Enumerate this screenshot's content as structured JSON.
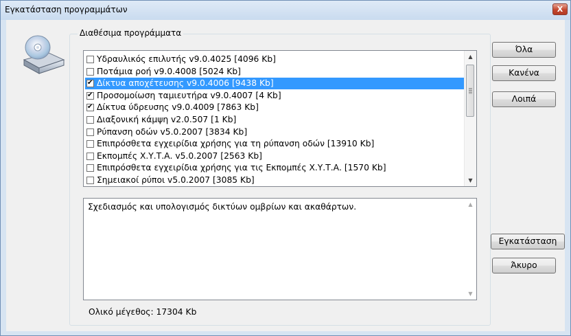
{
  "window": {
    "title": "Εγκατάσταση προγραμμάτων",
    "close_label": "X"
  },
  "group": {
    "label": "Διαθέσιμα προγράμματα"
  },
  "programs": [
    {
      "label": "Υδραυλικός επιλυτής v9.0.4025 [4096 Kb]",
      "checked": false,
      "selected": false
    },
    {
      "label": "Ποτάμια ροή v9.0.4008 [5024 Kb]",
      "checked": false,
      "selected": false
    },
    {
      "label": "Δίκτυα αποχέτευσης v9.0.4006 [9438 Kb]",
      "checked": true,
      "selected": true
    },
    {
      "label": "Προσομοίωση ταμιευτήρα v9.0.4007 [4 Kb]",
      "checked": true,
      "selected": false
    },
    {
      "label": "Δίκτυα ύδρευσης v9.0.4009 [7863 Kb]",
      "checked": true,
      "selected": false
    },
    {
      "label": "Διαξονική κάμψη v2.0.507 [1 Kb]",
      "checked": false,
      "selected": false
    },
    {
      "label": "Ρύπανση οδών v5.0.2007 [3834 Kb]",
      "checked": false,
      "selected": false
    },
    {
      "label": "Επιπρόσθετα εγχειρίδια χρήσης για τη ρύπανση οδών [13910 Kb]",
      "checked": false,
      "selected": false
    },
    {
      "label": "Εκπομπές Χ.Υ.Τ.Α. v5.0.2007 [2563 Kb]",
      "checked": false,
      "selected": false
    },
    {
      "label": "Επιπρόσθετα εγχειρίδια χρήσης για τις Εκπομπές Χ.Υ.Τ.Α. [1570 Kb]",
      "checked": false,
      "selected": false
    },
    {
      "label": "Σημειακοί ρύποι v5.0.2007 [3085 Kb]",
      "checked": false,
      "selected": false
    }
  ],
  "description": "Σχεδιασμός και υπολογισμός δικτύων ομβρίων και ακαθάρτων.",
  "total": "Ολικό μέγεθος: 17304 Kb",
  "buttons": {
    "all": "Όλα",
    "none": "Κανένα",
    "rest": "Λοιπά",
    "install": "Εγκατάσταση",
    "cancel": "Άκυρο"
  },
  "icons": {
    "app_icon": "cd-drive-icon",
    "scroll_up": "scroll-up-arrow-icon",
    "scroll_down": "scroll-down-arrow-icon"
  },
  "colors": {
    "selection": "#3399ff",
    "close_button": "#c4472f"
  }
}
